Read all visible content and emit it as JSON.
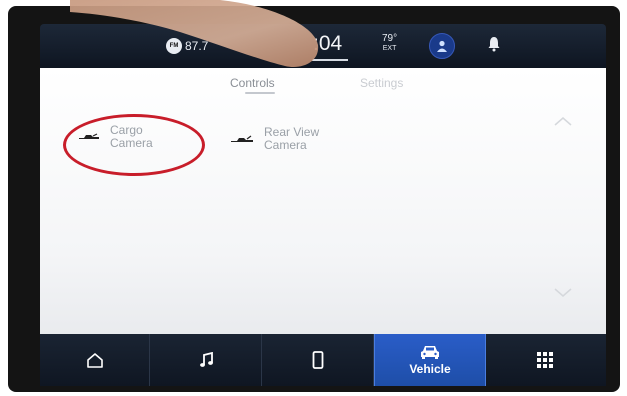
{
  "status_bar": {
    "radio_band": "FM",
    "radio_freq": "87.7",
    "clock": ":04",
    "temp_value": "79°",
    "temp_label": "EXT",
    "icons": [
      "fm-radio-icon",
      "profile-icon",
      "bell-icon"
    ]
  },
  "tabs": [
    {
      "label": "Controls",
      "active": true
    },
    {
      "label": "Settings",
      "active": false
    }
  ],
  "items": [
    {
      "label": "Cargo\nCamera",
      "icon": "camera-icon"
    },
    {
      "label": "Rear View\nCamera",
      "icon": "camera-icon"
    }
  ],
  "nav": {
    "items": [
      {
        "icon": "home-icon"
      },
      {
        "icon": "music-note-icon"
      },
      {
        "icon": "phone-icon"
      },
      {
        "icon": "car-icon",
        "label": "Vehicle",
        "active": true
      },
      {
        "icon": "apps-grid-icon"
      }
    ]
  },
  "colors": {
    "accent": "#2a5dc8",
    "highlight_circle": "#c81d2a",
    "status_bg": "#0e1521",
    "panel_bg": "#ffffff"
  }
}
